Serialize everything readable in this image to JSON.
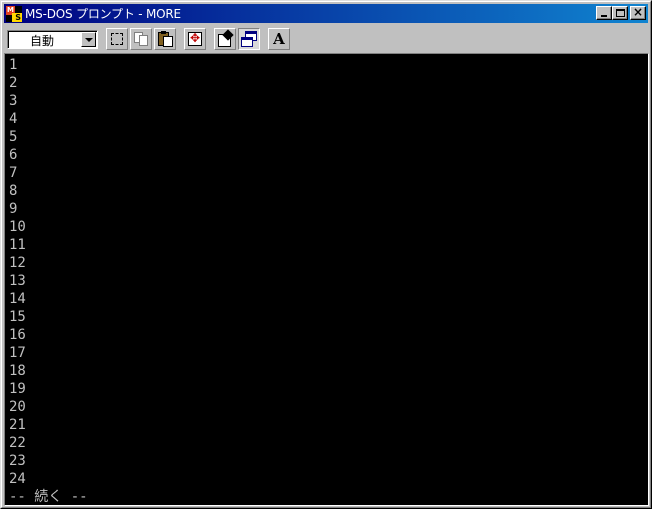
{
  "window": {
    "title": "MS-DOS プロンプト - MORE"
  },
  "toolbar": {
    "font_size_value": "自動"
  },
  "console": {
    "lines": [
      "1",
      "2",
      "3",
      "4",
      "5",
      "6",
      "7",
      "8",
      "9",
      "10",
      "11",
      "12",
      "13",
      "14",
      "15",
      "16",
      "17",
      "18",
      "19",
      "20",
      "21",
      "22",
      "23",
      "24"
    ],
    "prompt": "-- 続く --"
  },
  "colors": {
    "titlebar_start": "#000080",
    "titlebar_end": "#1084d0",
    "console_bg": "#000000",
    "console_fg": "#c0c0c0"
  }
}
